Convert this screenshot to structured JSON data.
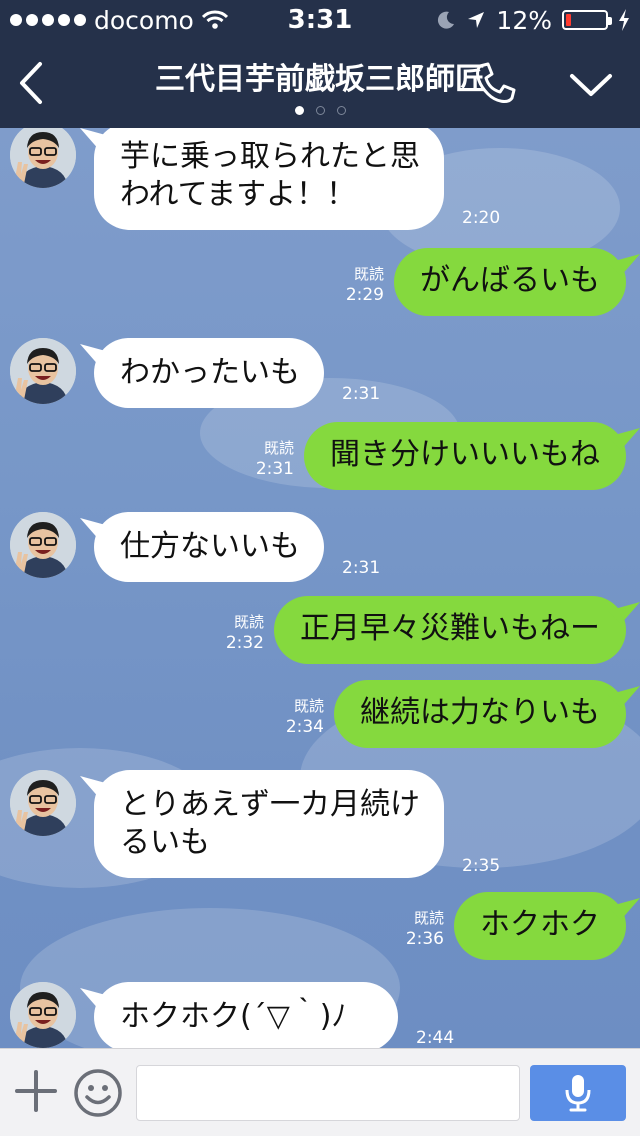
{
  "status_bar": {
    "carrier": "docomo",
    "signal_dots": 5,
    "time": "3:31",
    "battery": "12%",
    "battery_level": 0.12,
    "icons": [
      "signal-dots-icon",
      "wifi-icon",
      "do-not-disturb-moon-icon",
      "location-arrow-icon",
      "battery-icon",
      "charging-bolt-icon"
    ]
  },
  "header": {
    "title": "三代目芋前戯坂三郎師匠",
    "page_indicator": {
      "pages": 3,
      "current": 1
    },
    "icons": [
      "back-chevron-icon",
      "phone-call-icon",
      "chevron-down-icon"
    ]
  },
  "messages": [
    {
      "from": "them",
      "lines": [
        "芋に乗っ取られたと思",
        "われてますよ！！"
      ],
      "time": "2:20"
    },
    {
      "from": "me",
      "lines": [
        "がんばるいも"
      ],
      "read": "既読",
      "time": "2:29"
    },
    {
      "from": "them",
      "lines": [
        "わかったいも"
      ],
      "time": "2:31"
    },
    {
      "from": "me",
      "lines": [
        "聞き分けいいいもね"
      ],
      "read": "既読",
      "time": "2:31"
    },
    {
      "from": "them",
      "lines": [
        "仕方ないいも"
      ],
      "time": "2:31"
    },
    {
      "from": "me",
      "lines": [
        "正月早々災難いもねー"
      ],
      "read": "既読",
      "time": "2:32"
    },
    {
      "from": "me",
      "lines": [
        "継続は力なりいも"
      ],
      "read": "既読",
      "time": "2:34"
    },
    {
      "from": "them",
      "lines": [
        "とりあえず一カ月続け",
        "るいも"
      ],
      "time": "2:35"
    },
    {
      "from": "me",
      "lines": [
        "ホクホク"
      ],
      "read": "既読",
      "time": "2:36"
    },
    {
      "from": "them",
      "lines": [
        "ホクホク(´▽｀)ﾉ"
      ],
      "time": "2:44"
    }
  ],
  "input_bar": {
    "placeholder": "",
    "icons": [
      "plus-icon",
      "emoji-icon",
      "microphone-icon"
    ]
  },
  "colors": {
    "nav_background": "#25314a",
    "outgoing_bubble": "#85d93e",
    "incoming_bubble": "#ffffff",
    "chat_background": "#7797c8",
    "send_button": "#5a8ee6",
    "battery_low": "#ff3b30"
  }
}
